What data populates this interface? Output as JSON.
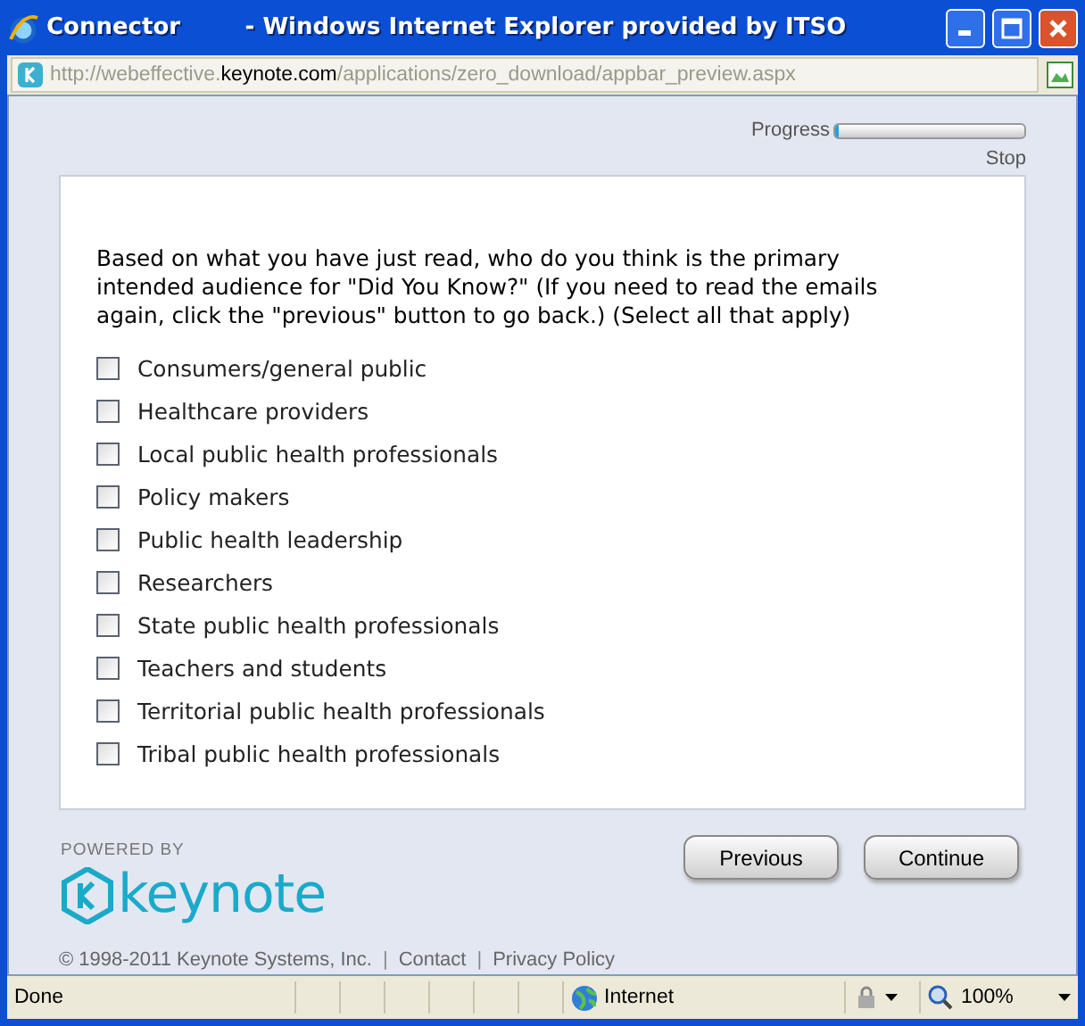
{
  "window": {
    "title": "Connector        - Windows Internet Explorer provided by ITSO"
  },
  "address_bar": {
    "prefix": "http://webeffective.",
    "domain": "keynote.com",
    "path": "/applications/zero_download/appbar_preview.aspx"
  },
  "progress": {
    "label": "Progress",
    "level": 0.02,
    "stop": "Stop"
  },
  "question": "Based on what you have just read, who do you think is the primary intended audience for \"Did You Know?\" (If you need to read the emails again, click the \"previous\" button to go back.) (Select all that apply)",
  "options": [
    {
      "label": "Consumers/general public",
      "checked": false
    },
    {
      "label": "Healthcare providers",
      "checked": false
    },
    {
      "label": "Local public health professionals",
      "checked": false
    },
    {
      "label": "Policy makers",
      "checked": false
    },
    {
      "label": "Public health leadership",
      "checked": false
    },
    {
      "label": "Researchers",
      "checked": false
    },
    {
      "label": "State public health professionals",
      "checked": false
    },
    {
      "label": "Teachers and students",
      "checked": false
    },
    {
      "label": "Territorial public health professionals",
      "checked": false
    },
    {
      "label": "Tribal public health professionals",
      "checked": false
    }
  ],
  "footer": {
    "powered_by": "POWERED BY",
    "brand": "keynote",
    "buttons": [
      "Previous",
      "Continue"
    ],
    "copyright": "© 1998-2011 Keynote Systems, Inc.",
    "separators": [
      "|",
      "|"
    ],
    "links": [
      "Contact",
      "Privacy Policy"
    ]
  },
  "status_bar": {
    "status": "Done",
    "zone": "Internet",
    "zoom": "100%"
  }
}
